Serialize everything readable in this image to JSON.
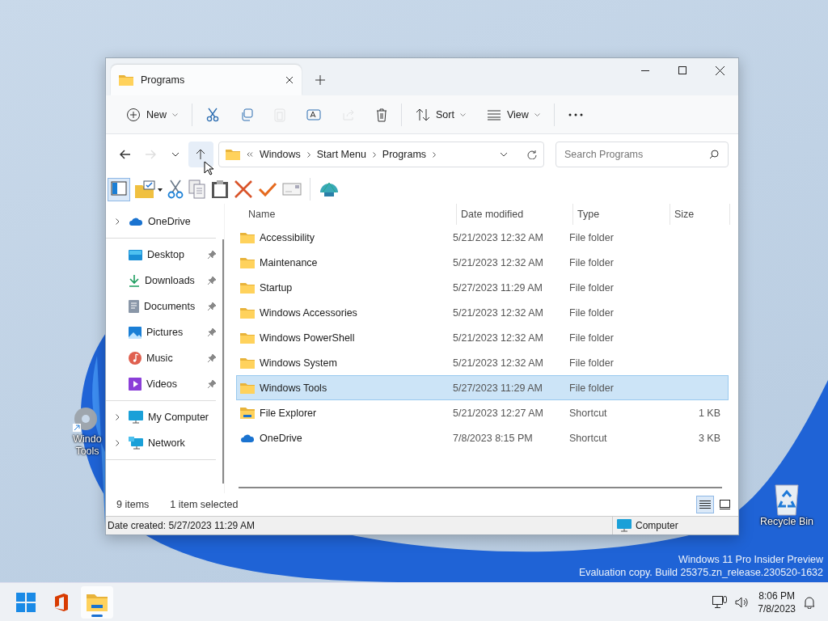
{
  "desktop_icons": [
    {
      "kind": "tools",
      "lines": [
        "Windo",
        "Tools"
      ]
    },
    {
      "kind": "recycle-bin",
      "lines": [
        "Recycle Bin"
      ]
    }
  ],
  "system_notice": [
    "Windows 11 Pro Insider Preview",
    "Evaluation copy. Build 25375.zn_release.230520-1632"
  ],
  "window": {
    "tabs": [
      {
        "label": "Programs",
        "selected": true
      }
    ],
    "command_bar": [
      {
        "kind": "new",
        "label": "New",
        "disabled": false
      },
      {
        "kind": "cut",
        "disabled": false
      },
      {
        "kind": "copy",
        "disabled": false
      },
      {
        "kind": "paste",
        "disabled": true
      },
      {
        "kind": "rename",
        "disabled": false
      },
      {
        "kind": "share",
        "disabled": true
      },
      {
        "kind": "delete",
        "disabled": false
      },
      {
        "kind": "sort",
        "label": "Sort",
        "disabled": false
      },
      {
        "kind": "view",
        "label": "View",
        "disabled": false
      },
      {
        "kind": "more",
        "disabled": false
      }
    ],
    "nav_buttons": [
      {
        "kind": "back",
        "disabled": false
      },
      {
        "kind": "forward",
        "disabled": true
      },
      {
        "kind": "recent",
        "disabled": false
      },
      {
        "kind": "up",
        "disabled": false
      }
    ],
    "address": {
      "breadcrumb": [
        "Windows",
        "Start Menu",
        "Programs"
      ]
    },
    "search": {
      "placeholder": "Search Programs"
    },
    "sidebar": {
      "groups": [
        {
          "items": [
            {
              "label": "OneDrive",
              "kind": "onedrive",
              "expandable": true,
              "pinned": false
            }
          ]
        },
        {
          "items": [
            {
              "label": "Desktop",
              "kind": "desktop",
              "expandable": false,
              "pinned": true
            },
            {
              "label": "Downloads",
              "kind": "downloads",
              "expandable": false,
              "pinned": true
            },
            {
              "label": "Documents",
              "kind": "documents",
              "expandable": false,
              "pinned": true
            },
            {
              "label": "Pictures",
              "kind": "pictures",
              "expandable": false,
              "pinned": true
            },
            {
              "label": "Music",
              "kind": "music",
              "expandable": false,
              "pinned": true
            },
            {
              "label": "Videos",
              "kind": "videos",
              "expandable": false,
              "pinned": true
            }
          ]
        },
        {
          "items": [
            {
              "label": "My Computer",
              "kind": "computer",
              "expandable": true,
              "pinned": false
            },
            {
              "label": "Network",
              "kind": "network",
              "expandable": true,
              "pinned": false
            }
          ]
        }
      ]
    },
    "table": {
      "columns": [
        "Name",
        "Date modified",
        "Type",
        "Size"
      ],
      "rows": [
        {
          "kind": "folder",
          "name": "Accessibility",
          "date": "5/21/2023 12:32 AM",
          "type": "File folder",
          "selected": false
        },
        {
          "kind": "folder",
          "name": "Maintenance",
          "date": "5/21/2023 12:32 AM",
          "type": "File folder",
          "selected": false
        },
        {
          "kind": "folder",
          "name": "Startup",
          "date": "5/27/2023 11:29 AM",
          "type": "File folder",
          "selected": false
        },
        {
          "kind": "folder",
          "name": "Windows Accessories",
          "date": "5/21/2023 12:32 AM",
          "type": "File folder",
          "selected": false
        },
        {
          "kind": "folder",
          "name": "Windows PowerShell",
          "date": "5/21/2023 12:32 AM",
          "type": "File folder",
          "selected": false
        },
        {
          "kind": "folder",
          "name": "Windows System",
          "date": "5/21/2023 12:32 AM",
          "type": "File folder",
          "selected": false
        },
        {
          "kind": "folder",
          "name": "Windows Tools",
          "date": "5/27/2023 11:29 AM",
          "type": "File folder",
          "selected": true
        },
        {
          "kind": "explorer",
          "name": "File Explorer",
          "date": "5/21/2023 12:27 AM",
          "type": "Shortcut",
          "size": "1 KB",
          "selected": false
        },
        {
          "kind": "onedrive",
          "name": "OneDrive",
          "date": "7/8/2023 8:15 PM",
          "type": "Shortcut",
          "size": "3 KB",
          "selected": false
        }
      ]
    },
    "status_bar": {
      "item_count": "9 items",
      "selection": "1 item selected",
      "views": [
        {
          "kind": "details",
          "selected": true
        },
        {
          "kind": "tiles",
          "selected": false
        }
      ]
    },
    "info_bar": {
      "details": "Date created: 5/27/2023 11:29 AM",
      "location": "Computer"
    }
  },
  "taskbar": {
    "apps": [
      {
        "kind": "start",
        "active": false
      },
      {
        "kind": "office",
        "active": false
      },
      {
        "kind": "explorer",
        "active": true
      }
    ],
    "clock": {
      "time": "8:06 PM",
      "date": "7/8/2023"
    }
  }
}
